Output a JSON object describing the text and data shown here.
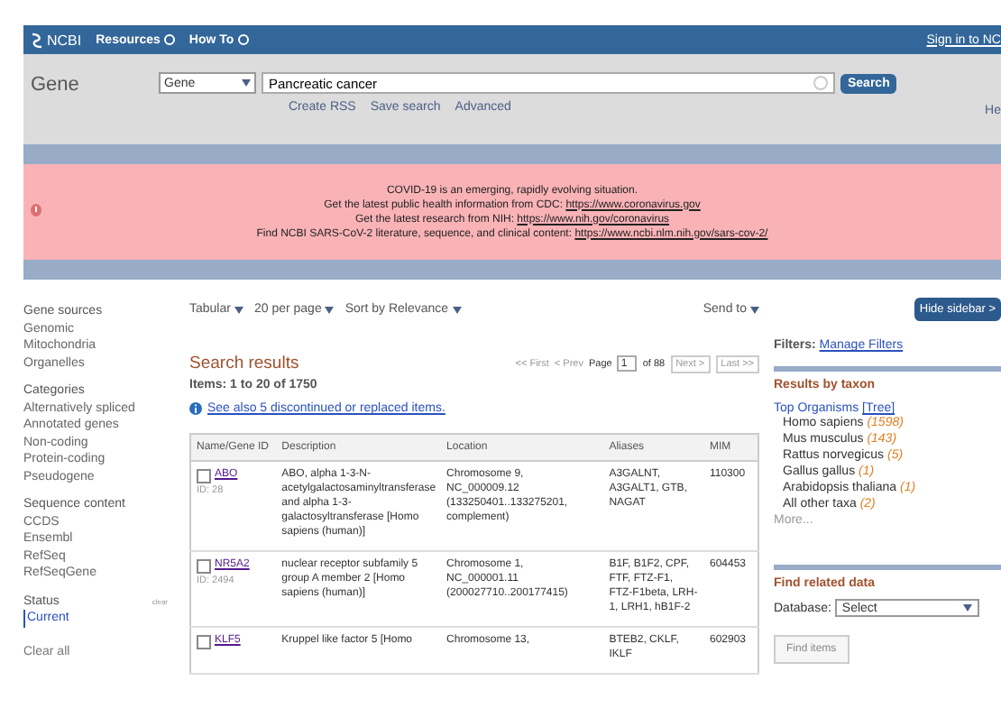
{
  "header": {
    "logo": "NCBI",
    "menus": [
      "Resources",
      "How To"
    ],
    "sign_in": "Sign in to NC"
  },
  "search": {
    "title": "Gene",
    "database": "Gene",
    "value": "Pancreatic cancer",
    "button": "Search",
    "links": [
      "Create RSS",
      "Save search",
      "Advanced"
    ],
    "help": "He"
  },
  "alert": {
    "lines": [
      {
        "text": "COVID-19 is an emerging, rapidly evolving situation."
      },
      {
        "text": "Get the latest public health information from CDC:",
        "link": "https://www.coronavirus.gov"
      },
      {
        "text": "Get the latest research from NIH:",
        "link": "https://www.nih.gov/coronavirus"
      },
      {
        "text": "Find NCBI SARS-CoV-2 literature, sequence, and clinical content:",
        "link": "https://www.ncbi.nlm.nih.gov/sars-cov-2/"
      }
    ]
  },
  "filters": [
    {
      "heading": "Gene sources",
      "items": [
        {
          "label": "Genomic",
          "selected": false
        },
        {
          "label": "Mitochondria",
          "selected": false
        },
        {
          "label": "Organelles",
          "selected": false
        }
      ]
    },
    {
      "heading": "Categories",
      "items": [
        {
          "label": "Alternatively spliced",
          "selected": false
        },
        {
          "label": "Annotated genes",
          "selected": false
        },
        {
          "label": "Non-coding",
          "selected": false
        },
        {
          "label": "Protein-coding",
          "selected": false
        },
        {
          "label": "Pseudogene",
          "selected": false
        }
      ]
    },
    {
      "heading": "Sequence content",
      "items": [
        {
          "label": "CCDS",
          "selected": false
        },
        {
          "label": "Ensembl",
          "selected": false
        },
        {
          "label": "RefSeq",
          "selected": false
        },
        {
          "label": "RefSeqGene",
          "selected": false
        }
      ]
    },
    {
      "heading": "Status",
      "clear": "clear",
      "items": [
        {
          "label": "Current",
          "selected": true
        }
      ]
    }
  ],
  "clear_all": "Clear all",
  "display_options": [
    "Tabular",
    "20 per page",
    "Sort by Relevance"
  ],
  "send_to": "Send to",
  "results": {
    "title": "Search results",
    "count": "Items: 1 to 20 of 1750",
    "notice": "See also 5 discontinued or replaced items.",
    "pager": {
      "first": "<< First",
      "prev": "< Prev",
      "page_label": "Page",
      "page": "1",
      "of": "of 88",
      "next": "Next >",
      "last": "Last >>"
    }
  },
  "table": {
    "columns": [
      "Name/Gene ID",
      "Description",
      "Location",
      "Aliases",
      "MIM"
    ],
    "rows": [
      {
        "name": "ABO",
        "id": "ID: 28",
        "checked": false,
        "description": "ABO, alpha 1-3-N-acetylgalactosaminyltransferase and alpha 1-3-galactosyltransferase [Homo sapiens (human)]",
        "location": "Chromosome 9, NC_000009.12 (133250401..133275201, complement)",
        "aliases": "A3GALNT, A3GALT1, GTB, NAGAT",
        "mim": "110300"
      },
      {
        "name": "NR5A2",
        "id": "ID: 2494",
        "checked": false,
        "description": "nuclear receptor subfamily 5 group A member 2 [Homo sapiens (human)]",
        "location": "Chromosome 1, NC_000001.11 (200027710..200177415)",
        "aliases": "B1F, B1F2, CPF, FTF, FTZ-F1, FTZ-F1beta, LRH-1, LRH1, hB1F-2",
        "mim": "604453"
      },
      {
        "name": "KLF5",
        "checked": false,
        "description": "Kruppel like factor 5 [Homo",
        "location": "Chromosome 13,",
        "aliases": "BTEB2, CKLF, IKLF",
        "mim": "602903"
      }
    ]
  },
  "sidebar": {
    "hide_button": "Hide sidebar >",
    "filters_label": "Filters:",
    "manage_filters": "Manage Filters",
    "taxon": {
      "title": "Results by taxon",
      "top": "Top Organisms",
      "tree": "[Tree]",
      "organisms": [
        {
          "name": "Homo sapiens",
          "count": "(1598)"
        },
        {
          "name": "Mus musculus",
          "count": "(143)"
        },
        {
          "name": "Rattus norvegicus",
          "count": "(5)"
        },
        {
          "name": "Gallus gallus",
          "count": "(1)"
        },
        {
          "name": "Arabidopsis thaliana",
          "count": "(1)"
        },
        {
          "name": "All other taxa",
          "count": "(2)"
        }
      ],
      "more": "More..."
    },
    "related": {
      "title": "Find related data",
      "database_label": "Database:",
      "database": "Select",
      "button": "Find items"
    }
  }
}
